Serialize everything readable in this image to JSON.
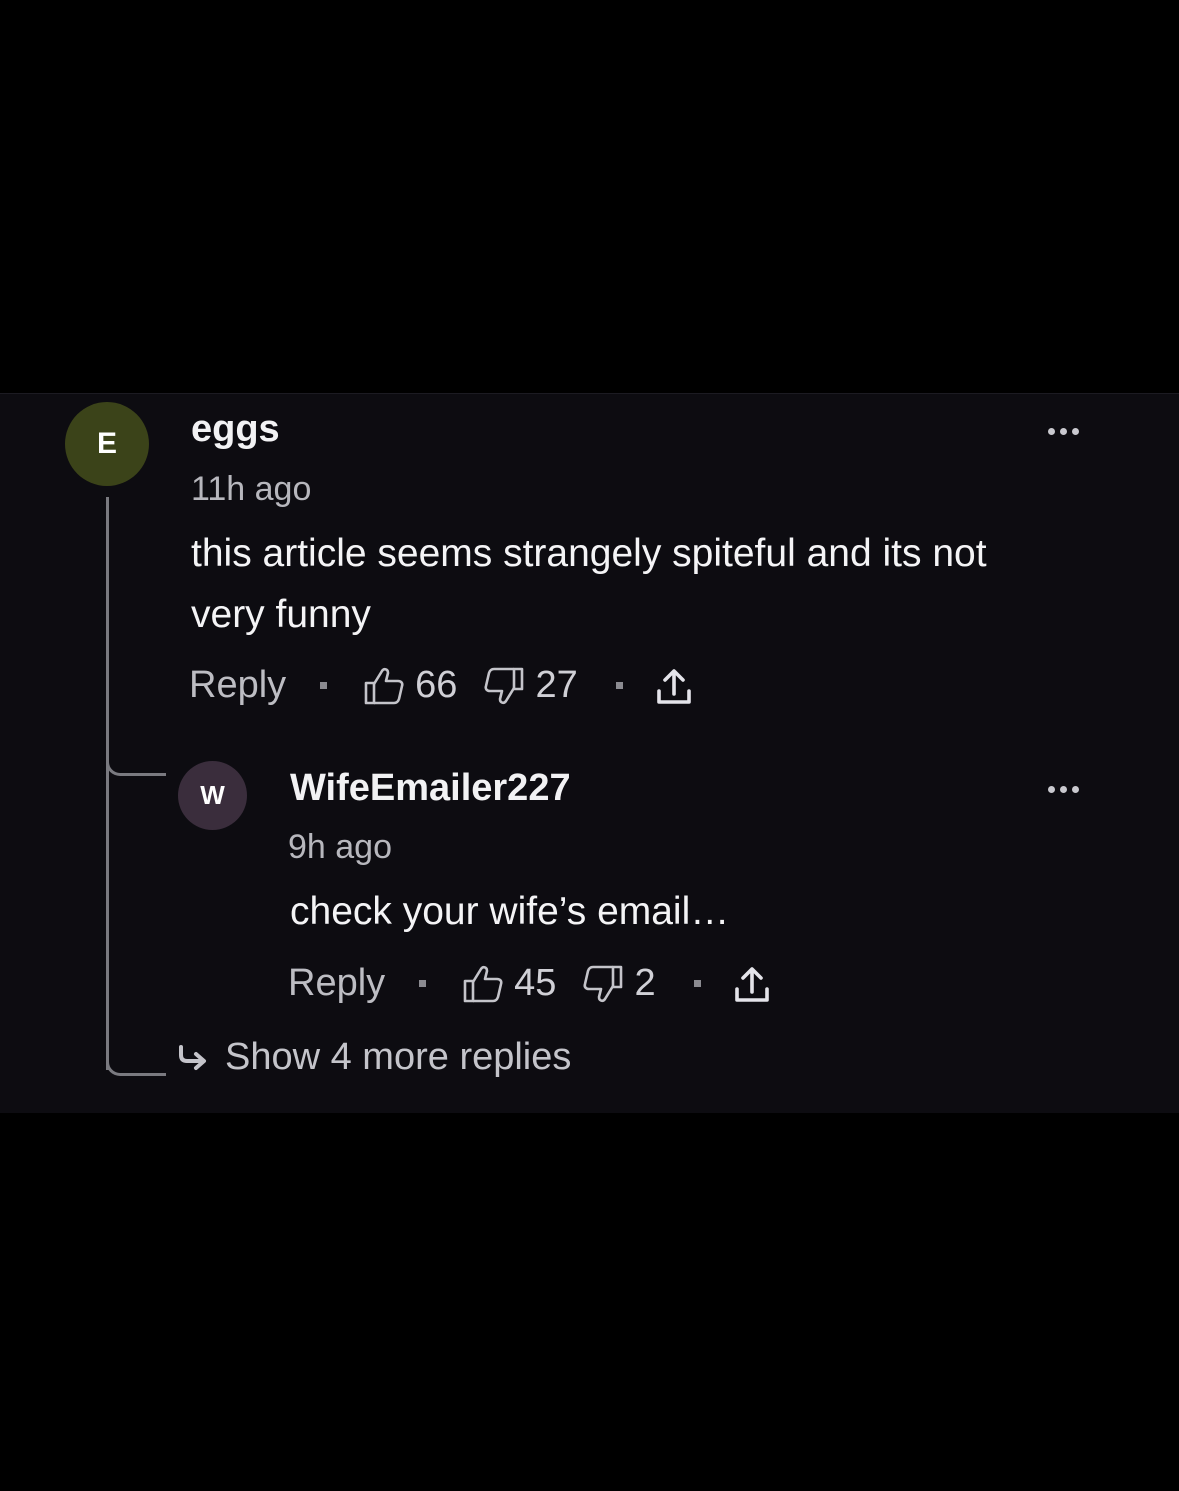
{
  "colors": {
    "page_background": "#000000",
    "panel_background": "#0d0c11",
    "avatar_e": "#3b4319",
    "avatar_w": "#3a2d3c",
    "thread_line": "#7a7a80"
  },
  "comments": [
    {
      "avatar_letter": "E",
      "username": "eggs",
      "timestamp": "11h ago",
      "body_line_1": "this article seems strangely spiteful and its not",
      "body_line_2": "very funny",
      "reply_label": "Reply",
      "likes": "66",
      "dislikes": "27",
      "more_icon": "more-horizontal-icon",
      "like_icon": "thumbs-up-icon",
      "dislike_icon": "thumbs-down-icon",
      "share_icon": "share-upload-icon"
    },
    {
      "avatar_letter": "W",
      "username": "WifeEmailer227",
      "timestamp": "9h ago",
      "body_line_1": "check your wife’s email…",
      "reply_label": "Reply",
      "likes": "45",
      "dislikes": "2",
      "more_icon": "more-horizontal-icon",
      "like_icon": "thumbs-up-icon",
      "dislike_icon": "thumbs-down-icon",
      "share_icon": "share-upload-icon"
    }
  ],
  "show_more": {
    "label": "Show 4 more replies",
    "icon": "reply-arrow-icon"
  }
}
